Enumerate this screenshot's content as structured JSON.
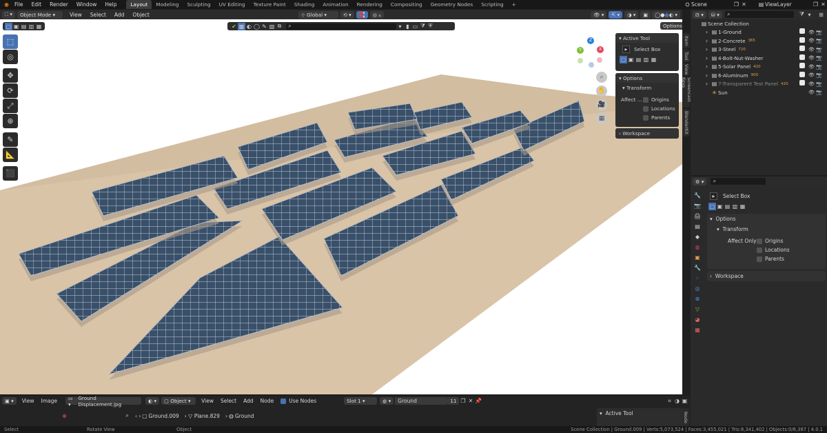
{
  "menus": [
    "File",
    "Edit",
    "Render",
    "Window",
    "Help"
  ],
  "workspaces": [
    "Layout",
    "Modeling",
    "Sculpting",
    "UV Editing",
    "Texture Paint",
    "Shading",
    "Animation",
    "Rendering",
    "Compositing",
    "Geometry Nodes",
    "Scripting"
  ],
  "active_workspace": "Layout",
  "add_tab": "+",
  "scene_name": "Scene",
  "view_layer": "ViewLayer",
  "viewport": {
    "mode": "Object Mode",
    "header_menus": [
      "View",
      "Select",
      "Add",
      "Object"
    ],
    "orientation": "Global",
    "options_label": "Options",
    "gizmo_axes": {
      "z": "Z",
      "y": "Y",
      "x": "X"
    }
  },
  "npanel": {
    "active_tool_title": "Active Tool",
    "active_tool_name": "Select Box",
    "options_title": "Options",
    "transform_title": "Transform",
    "affect_label": "Affect ...",
    "affect_items": [
      "Origins",
      "Locations",
      "Parents"
    ],
    "workspace_title": "Workspace",
    "side_tabs": [
      "Item",
      "Tool",
      "View",
      "Screencast Keys",
      "BlenderKit"
    ]
  },
  "outliner": {
    "root": "Scene Collection",
    "items": [
      {
        "name": "1-Ground",
        "badge": ""
      },
      {
        "name": "2-Concrete",
        "badge": "365"
      },
      {
        "name": "3-Steel",
        "badge": "720"
      },
      {
        "name": "4-Bolt-Nut-Washer",
        "badge": ""
      },
      {
        "name": "5-Solar Panel",
        "badge": "420"
      },
      {
        "name": "6-Aluminum",
        "badge": "900"
      },
      {
        "name": "7-Transparent Test Panel",
        "badge": "420"
      },
      {
        "name": "Sun",
        "badge": ""
      }
    ]
  },
  "properties": {
    "tool_name": "Select Box",
    "options_title": "Options",
    "transform_title": "Transform",
    "affect_only": "Affect Only",
    "affect_items": [
      "Origins",
      "Locations",
      "Parents"
    ],
    "workspace_title": "Workspace"
  },
  "shader_editor": {
    "menus": [
      "View",
      "Image"
    ],
    "image_name": "Ground Displacement.jpg",
    "object_label": "Object",
    "menus2": [
      "View",
      "Select",
      "Add",
      "Node"
    ],
    "use_nodes": "Use Nodes",
    "slot": "Slot 1",
    "material": "Ground",
    "users": "11",
    "breadcrumb": [
      "Ground.009",
      "Plane.829",
      "Ground"
    ],
    "active_tool": "Active Tool",
    "node_tab": "Node"
  },
  "status": {
    "left": [
      "Select",
      "Rotate View",
      "Object"
    ],
    "stats": "Scene Collection | Ground.009 | Verts:5,073,524 | Faces:3,455,021 | Tris:8,341,402 | Objects:0/6,387 | 4.0.1"
  },
  "colors": {
    "accent": "#4772b3",
    "ground": "#d9c4a8",
    "panel": "#33475e",
    "frame": "#b8bcc0"
  }
}
